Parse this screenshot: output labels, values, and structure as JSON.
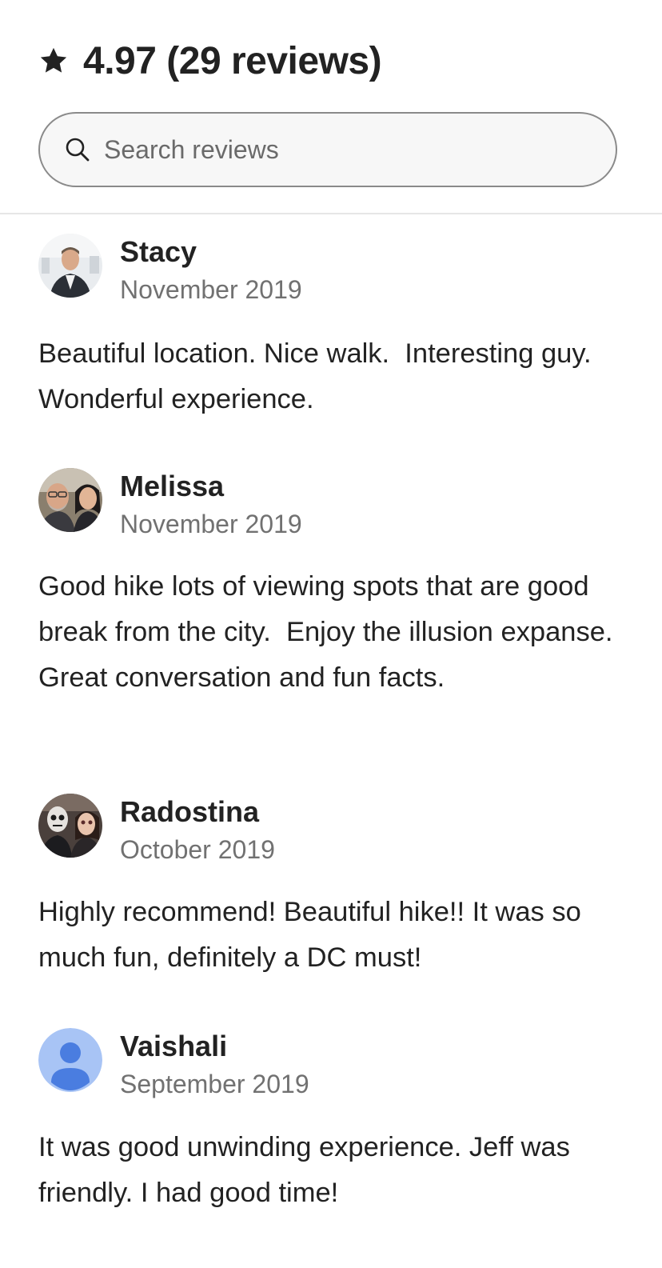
{
  "summary": {
    "rating_text": "4.97 (29 reviews)"
  },
  "search": {
    "placeholder": "Search reviews",
    "value": ""
  },
  "reviews": [
    {
      "name": "Stacy",
      "date": "November 2019",
      "text": "Beautiful location. Nice walk.  Interesting guy.  Wonderful experience."
    },
    {
      "name": "Melissa",
      "date": "November 2019",
      "text": "Good hike lots of viewing spots that are good break from the city.  Enjoy the illusion expanse. Great conversation and fun facts."
    },
    {
      "name": "Radostina",
      "date": "October 2019",
      "text": "Highly recommend! Beautiful hike!! It was so much fun, definitely a DC must!"
    },
    {
      "name": "Vaishali",
      "date": "September 2019",
      "text": "It was good unwinding experience. Jeff was friendly. I had good time!"
    }
  ],
  "colors": {
    "text_primary": "#222222",
    "text_secondary": "#717171",
    "divider": "#e6e6e6",
    "default_avatar_bg": "#a8c4f5",
    "default_avatar_fg": "#4a7de0"
  },
  "icons": {
    "rating": "star-icon",
    "search": "search-icon",
    "default_avatar": "person-icon"
  }
}
